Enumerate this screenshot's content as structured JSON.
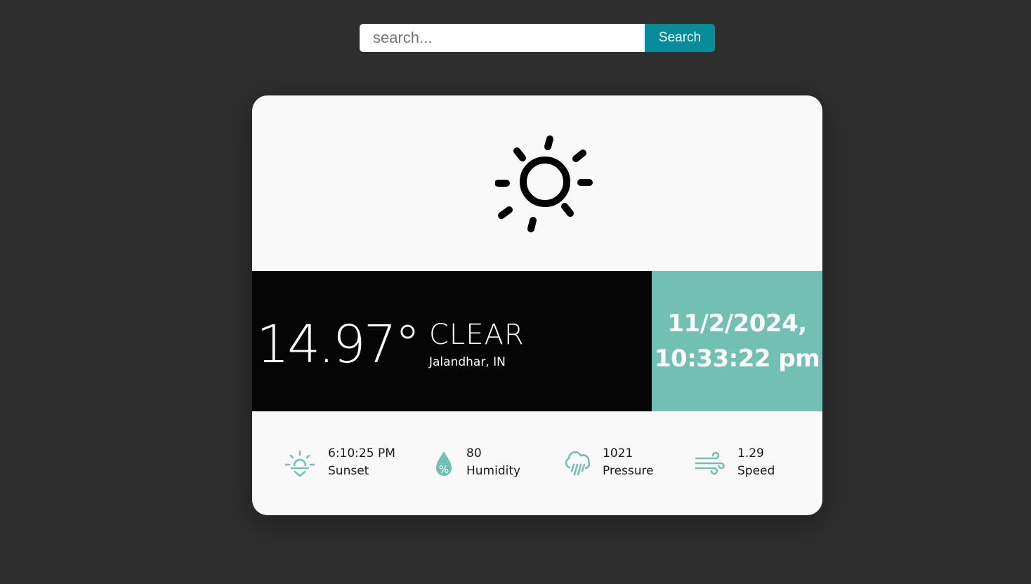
{
  "search": {
    "placeholder": "search...",
    "value": "",
    "button_label": "Search"
  },
  "weather": {
    "icon": "sun-icon",
    "temperature": "14.97°",
    "condition": "CLEAR",
    "location": "Jalandhar, IN"
  },
  "datetime": {
    "date": "11/2/2024,",
    "time": "10:33:22 pm"
  },
  "stats": [
    {
      "icon": "sunset-icon",
      "value": "6:10:25 PM",
      "label": "Sunset"
    },
    {
      "icon": "humidity-icon",
      "value": "80",
      "label": "Humidity"
    },
    {
      "icon": "pressure-icon",
      "value": "1021",
      "label": "Pressure"
    },
    {
      "icon": "wind-icon",
      "value": "1.29",
      "label": "Speed"
    }
  ],
  "colors": {
    "background": "#2e2e2e",
    "card": "#f9f9f9",
    "band_dark": "#060505",
    "accent_teal": "#72c0b3",
    "search_button": "#078c9a"
  }
}
